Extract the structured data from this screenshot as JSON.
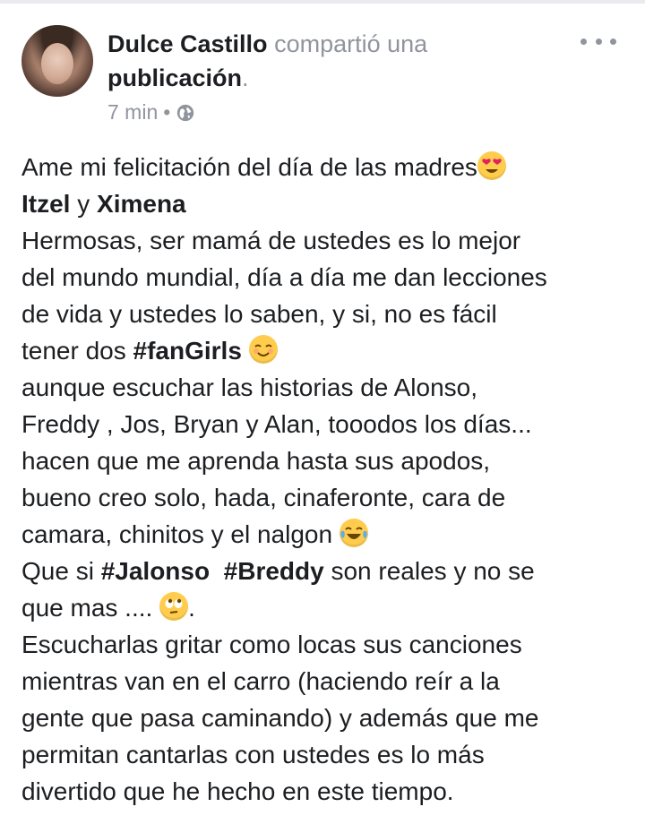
{
  "post_header": {
    "author": "Dulce Castillo",
    "action": "compartió una",
    "object": "publicación",
    "period": ".",
    "time": "7 min",
    "separator": "•",
    "privacy_icon": "globe-icon",
    "menu_icon": "more-options-icon"
  },
  "post_body": {
    "l1": "Ame mi felicitación del día de las madres",
    "l2_a": "Itzel",
    "l2_b": " y ",
    "l2_c": "Ximena",
    "l3": "Hermosas, ser mamá  de ustedes es lo mejor",
    "l4": "del mundo mundial, día a día me dan lecciones",
    "l5": "de vida y ustedes lo saben, y si, no es fácil",
    "l6_a": "tener dos ",
    "l6_b": "#fanGirls",
    "l7": "aunque escuchar las historias de Alonso,",
    "l8": "Freddy , Jos, Bryan  y Alan,  tooodos los días...",
    "l9": "hacen que me aprenda hasta sus apodos,",
    "l10": "bueno creo solo, hada, cinaferonte, cara de",
    "l11": "camara, chinitos  y el nalgon",
    "l12_a": " Que si ",
    "l12_b": "#Jalonso",
    "l12_c": "  ",
    "l12_d": "#Breddy",
    "l12_e": " son reales  y no se",
    "l13_a": "que mas .... ",
    "l13_b": ".",
    "l14": "Escucharlas  gritar como locas sus canciones",
    "l15": "mientras van en el carro (haciendo reír a la",
    "l16": "gente que pasa caminando) y además que me",
    "l17": "permitan cantarlas con ustedes es lo más",
    "l18": "divertido que he hecho en  este tiempo."
  },
  "emojis": [
    "heart-eyes-emoji",
    "smiling-blush-emoji",
    "tears-of-joy-emoji",
    "eye-roll-emoji"
  ],
  "colors": {
    "name": "#1c1e21",
    "secondary": "#90949c",
    "emoji_yellow": "#ffcc4d"
  }
}
